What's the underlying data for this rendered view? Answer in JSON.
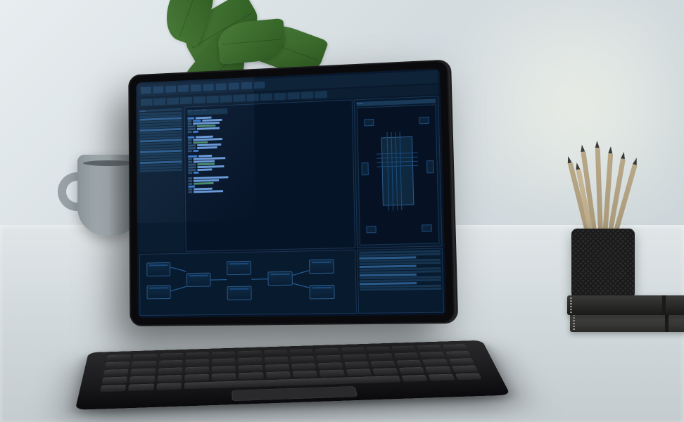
{
  "scene": {
    "description": "Product photo of a tablet with keyboard case on a white desk, running a dark-blue embedded-systems / hardware IDE. Potted plant and grey mug to the left, mesh pencil cup and two stacked black notebooks to the right.",
    "ambient": "soft daylight, blurred bright window background"
  },
  "desk_objects": {
    "mug": {
      "color": "matte grey",
      "position": "left"
    },
    "plant": {
      "type": "broad-leaf houseplant",
      "pot": "dark woven/textured"
    },
    "pencil_cup": {
      "type": "black wire mesh",
      "contents": "wooden pencils",
      "count_approx": 7
    },
    "notebooks": {
      "count": 2,
      "color": "black/charcoal",
      "stacked": true
    }
  },
  "device": {
    "type": "tablet with detachable keyboard folio",
    "bezel_color": "black",
    "keyboard_color": "dark grey"
  },
  "ide": {
    "theme": "dark navy blue",
    "accent_color": "#2a6aaa",
    "layout": {
      "menubar": true,
      "toolbar": true,
      "left_sidebar": "file/project tree",
      "center": "code editor",
      "right": "chip/pinout inspector",
      "bottom": "visual node/flow graph",
      "bottom_right": "properties list"
    },
    "menubar_items_count": 10,
    "toolbar_buttons_count": 14,
    "sidebar": {
      "title": "Project",
      "items_count_approx": 22
    },
    "editor": {
      "open_tab": "main source file",
      "visible_lines_approx": 30,
      "syntax_tokens": [
        "keyword",
        "identifier",
        "string",
        "comment"
      ]
    },
    "inspector": {
      "title": "Device",
      "diagram": "central IC package with peripheral blocks and pin traces",
      "peripheral_blocks": 6
    },
    "node_graph": {
      "nodes_count": 8,
      "connections_count_approx": 6
    },
    "properties_rows_approx": 14
  },
  "colors": {
    "screen_bg": "#061224",
    "panel_bg": "#081a2e",
    "panel_border": "#1a3452",
    "highlight": "#2a5a8a",
    "mug": "#98a2a6",
    "desk": "#d4dce0"
  }
}
